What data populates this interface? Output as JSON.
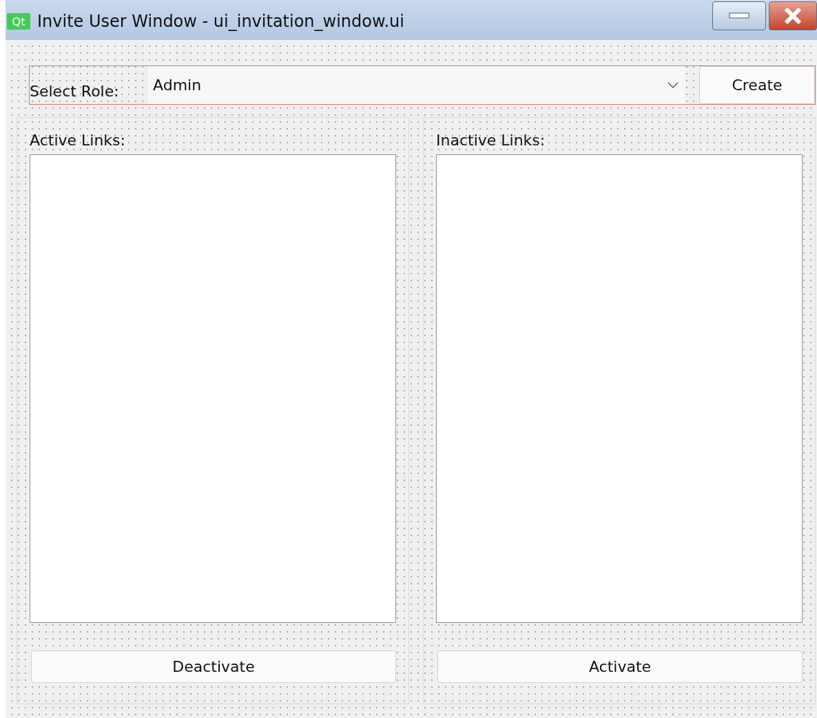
{
  "window": {
    "title": "Invite User Window - ui_invitation_window.ui",
    "logo": "Qt"
  },
  "role_bar": {
    "label": "Select Role:",
    "combo": {
      "value": "Admin"
    },
    "button": "Create"
  },
  "panels": [
    {
      "label": "Active Links:",
      "button": "Deactivate"
    },
    {
      "label": "Inactive Links:",
      "button": "Activate"
    }
  ]
}
